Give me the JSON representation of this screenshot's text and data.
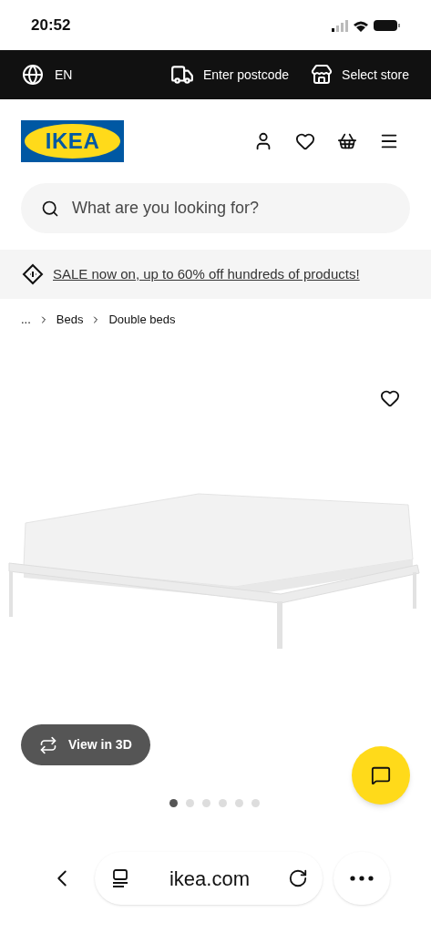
{
  "status_bar": {
    "time": "20:52"
  },
  "top_bar": {
    "language": "EN",
    "postcode": "Enter postcode",
    "store": "Select store"
  },
  "header": {
    "logo": "IKEA"
  },
  "search": {
    "placeholder": "What are you looking for?"
  },
  "promo": {
    "text": "SALE now on, up to 60% off hundreds of products!"
  },
  "breadcrumbs": [
    "...",
    "Beds",
    "Double beds"
  ],
  "gallery": {
    "view_3d": "View in 3D",
    "dots": [
      {
        "selected": true
      },
      {
        "selected": false
      },
      {
        "selected": false
      },
      {
        "selected": false
      },
      {
        "selected": false
      },
      {
        "selected": false
      }
    ]
  },
  "browser_bar": {
    "url": "ikea.com"
  }
}
